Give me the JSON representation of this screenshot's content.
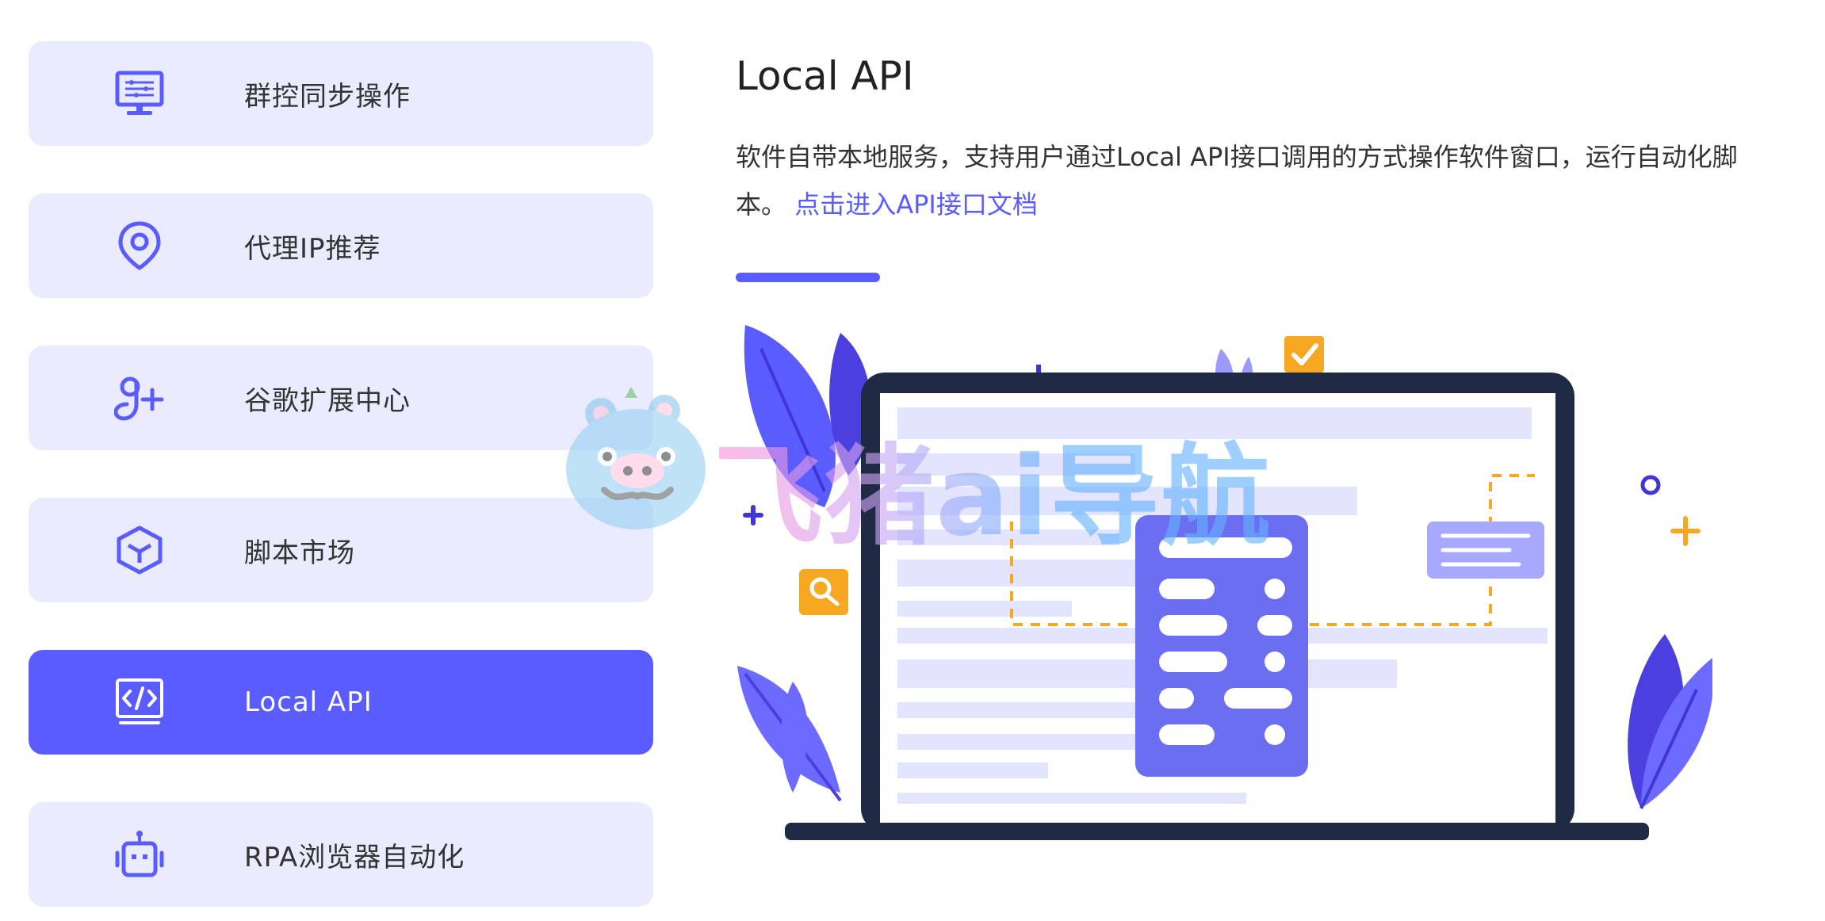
{
  "sidebar": {
    "items": [
      {
        "label": "群控同步操作",
        "icon": "monitor-icon",
        "active": false
      },
      {
        "label": "代理IP推荐",
        "icon": "location-pin-icon",
        "active": false
      },
      {
        "label": "谷歌扩展中心",
        "icon": "google-plus-icon",
        "active": false
      },
      {
        "label": "脚本市场",
        "icon": "cube-icon",
        "active": false
      },
      {
        "label": "Local API",
        "icon": "code-window-icon",
        "active": true
      },
      {
        "label": "RPA浏览器自动化",
        "icon": "robot-icon",
        "active": false
      }
    ]
  },
  "main": {
    "title": "Local API",
    "description": "软件自带本地服务，支持用户通过Local API接口调用的方式操作软件窗口，运行自动化脚本。",
    "link_text": "点击进入API接口文档"
  },
  "watermark": {
    "text": "飞猪ai导航"
  },
  "colors": {
    "accent": "#5b5cff",
    "item_bg": "#eaebff",
    "text": "#333333",
    "illustration_orange": "#f7a823",
    "laptop_frame": "#1f2a44"
  }
}
